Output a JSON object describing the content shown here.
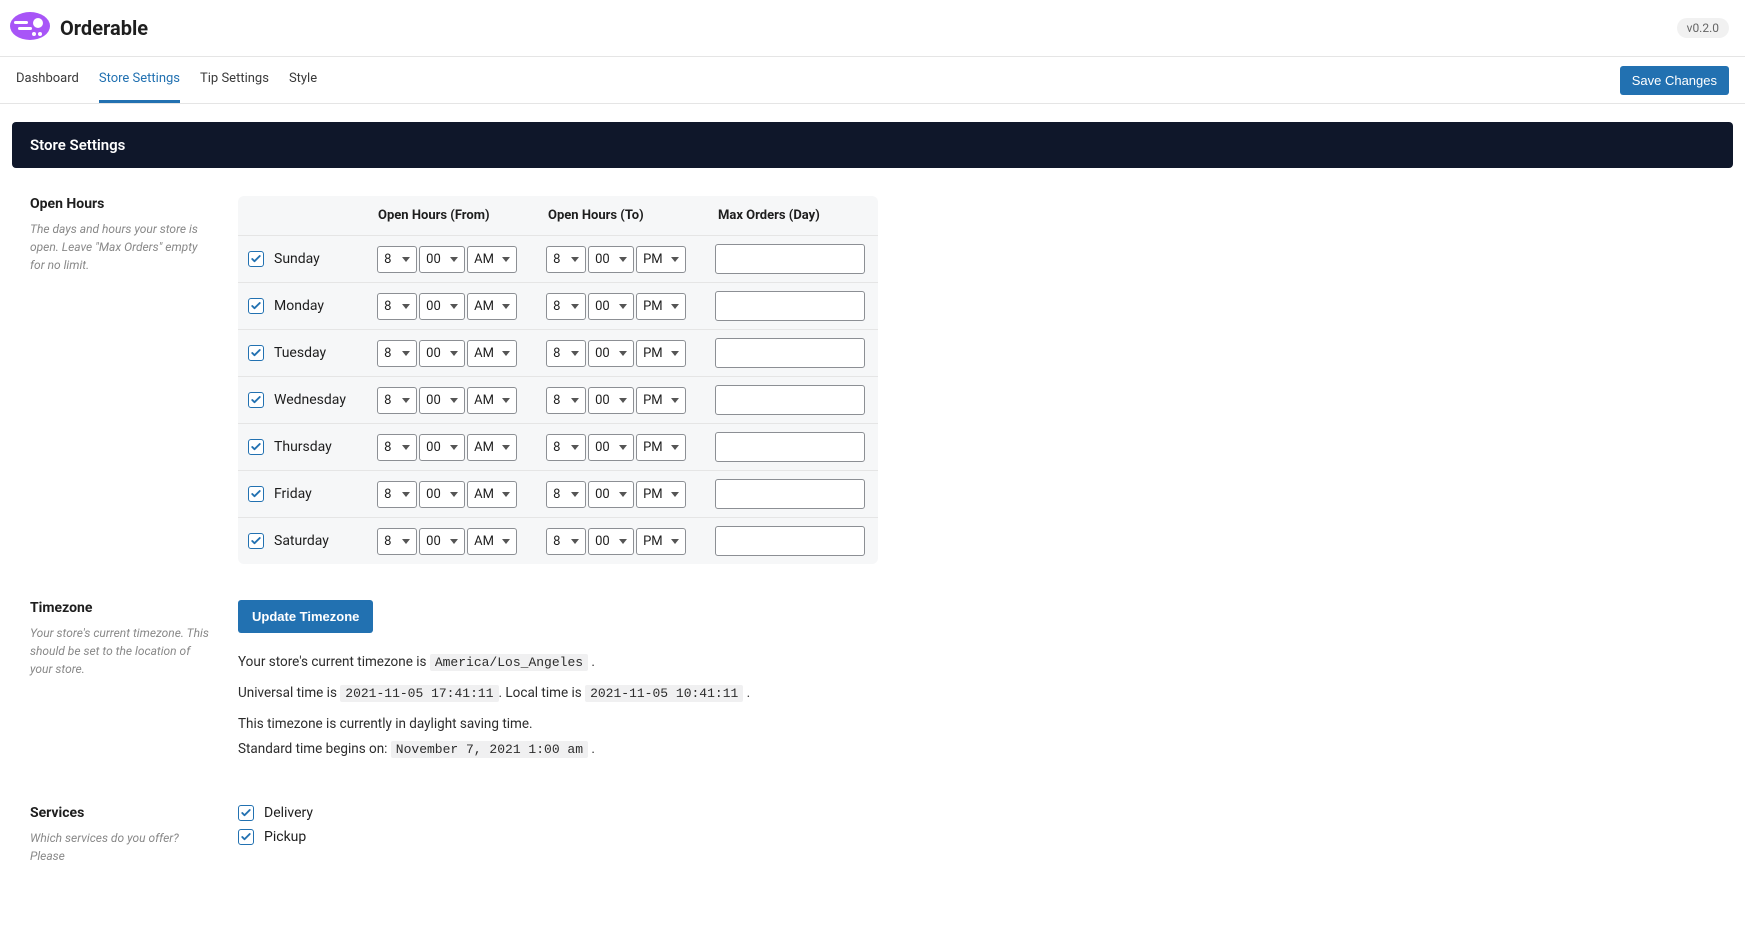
{
  "brand": {
    "name": "Orderable",
    "version": "v0.2.0"
  },
  "nav": {
    "tabs": [
      {
        "label": "Dashboard",
        "active": false
      },
      {
        "label": "Store Settings",
        "active": true
      },
      {
        "label": "Tip Settings",
        "active": false
      },
      {
        "label": "Style",
        "active": false
      }
    ],
    "save_label": "Save Changes"
  },
  "page_title": "Store Settings",
  "open_hours": {
    "heading": "Open Hours",
    "desc": "The days and hours your store is open. Leave \"Max Orders\" empty for no limit.",
    "columns": {
      "from": "Open Hours (From)",
      "to": "Open Hours (To)",
      "max": "Max Orders (Day)"
    },
    "days": [
      {
        "day": "Sunday",
        "enabled": true,
        "from_h": "8",
        "from_m": "00",
        "from_p": "AM",
        "to_h": "8",
        "to_m": "00",
        "to_p": "PM",
        "max": ""
      },
      {
        "day": "Monday",
        "enabled": true,
        "from_h": "8",
        "from_m": "00",
        "from_p": "AM",
        "to_h": "8",
        "to_m": "00",
        "to_p": "PM",
        "max": ""
      },
      {
        "day": "Tuesday",
        "enabled": true,
        "from_h": "8",
        "from_m": "00",
        "from_p": "AM",
        "to_h": "8",
        "to_m": "00",
        "to_p": "PM",
        "max": ""
      },
      {
        "day": "Wednesday",
        "enabled": true,
        "from_h": "8",
        "from_m": "00",
        "from_p": "AM",
        "to_h": "8",
        "to_m": "00",
        "to_p": "PM",
        "max": ""
      },
      {
        "day": "Thursday",
        "enabled": true,
        "from_h": "8",
        "from_m": "00",
        "from_p": "AM",
        "to_h": "8",
        "to_m": "00",
        "to_p": "PM",
        "max": ""
      },
      {
        "day": "Friday",
        "enabled": true,
        "from_h": "8",
        "from_m": "00",
        "from_p": "AM",
        "to_h": "8",
        "to_m": "00",
        "to_p": "PM",
        "max": ""
      },
      {
        "day": "Saturday",
        "enabled": true,
        "from_h": "8",
        "from_m": "00",
        "from_p": "AM",
        "to_h": "8",
        "to_m": "00",
        "to_p": "PM",
        "max": ""
      }
    ]
  },
  "timezone": {
    "heading": "Timezone",
    "desc": "Your store's current timezone. This should be set to the location of your store.",
    "update_btn": "Update Timezone",
    "current_prefix": "Your store's current timezone is ",
    "current_tz": "America/Los_Angeles",
    "universal_prefix": "Universal time is ",
    "universal_time": "2021-11-05 17:41:11",
    "local_prefix": ". Local time is ",
    "local_time": "2021-11-05 10:41:11",
    "dst_line": "This timezone is currently in daylight saving time.",
    "std_prefix": "Standard time begins on: ",
    "std_time": "November 7, 2021 1:00 am"
  },
  "services": {
    "heading": "Services",
    "desc": "Which services do you offer? Please",
    "options": [
      {
        "label": "Delivery",
        "checked": true
      },
      {
        "label": "Pickup",
        "checked": true
      }
    ]
  }
}
